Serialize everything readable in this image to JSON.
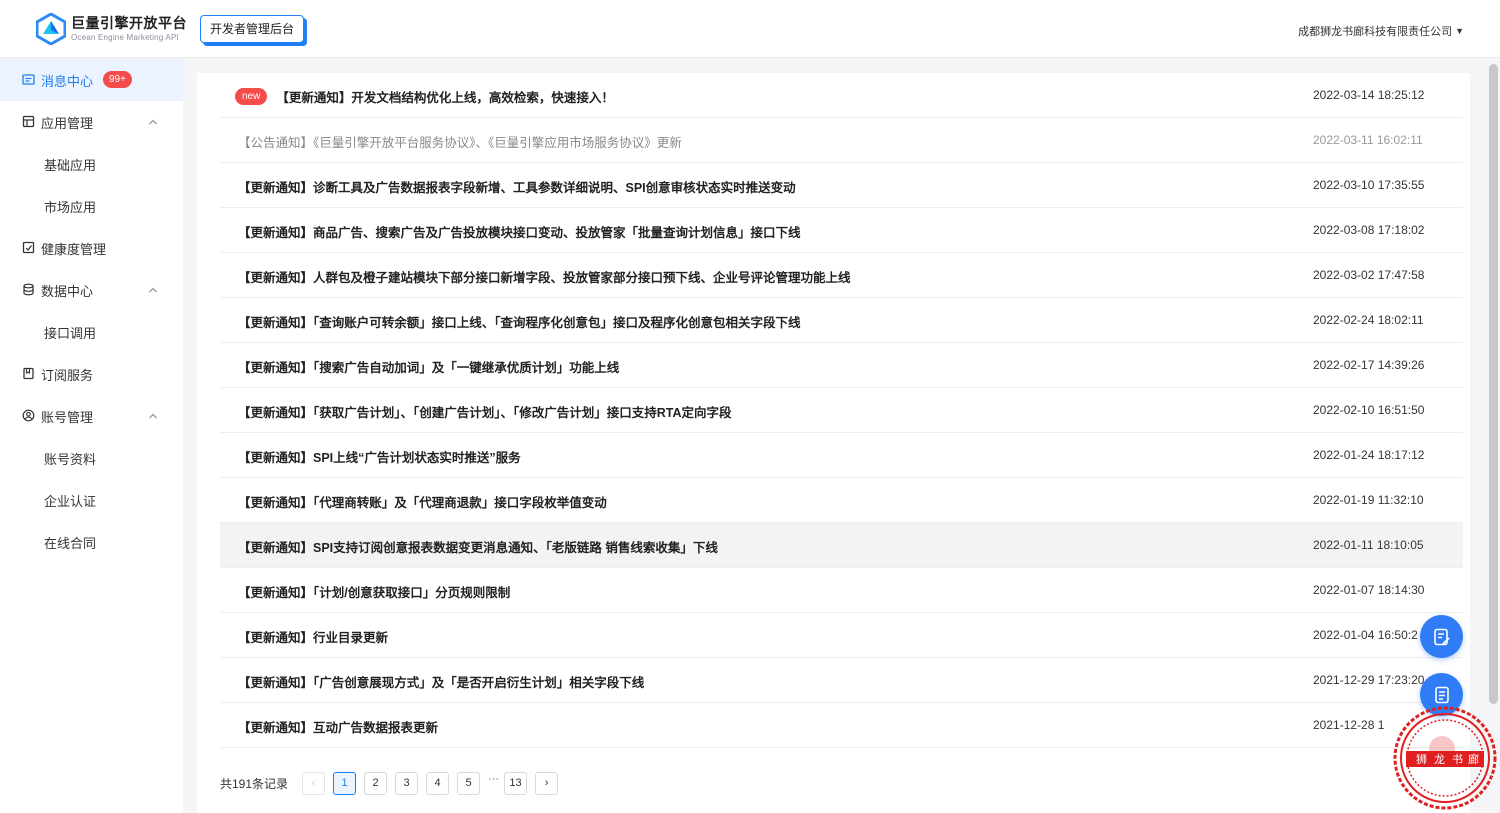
{
  "header": {
    "brand_title": "巨量引擎开放平台",
    "brand_subtitle": "Ocean Engine Marketing API",
    "dev_badge": "开发者管理后台",
    "company": "成都狮龙书廊科技有限责任公司",
    "accent_color": "#1e7ef2"
  },
  "sidebar": {
    "items": [
      {
        "label": "消息中心",
        "icon": "message-icon",
        "badge": "99+",
        "active": true
      },
      {
        "label": "应用管理",
        "icon": "app-icon",
        "expanded": true
      },
      {
        "label": "基础应用",
        "sub": true
      },
      {
        "label": "市场应用",
        "sub": true
      },
      {
        "label": "健康度管理",
        "icon": "health-icon"
      },
      {
        "label": "数据中心",
        "icon": "database-icon",
        "expanded": true
      },
      {
        "label": "接口调用",
        "sub": true
      },
      {
        "label": "订阅服务",
        "icon": "bookmark-icon"
      },
      {
        "label": "账号管理",
        "icon": "account-icon",
        "expanded": true
      },
      {
        "label": "账号资料",
        "sub": true
      },
      {
        "label": "企业认证",
        "sub": true
      },
      {
        "label": "在线合同",
        "sub": true
      }
    ]
  },
  "messages": [
    {
      "title": "【更新通知】开发文档结构优化上线，高效检索，快速接入！",
      "time": "2022-03-14 18:25:12",
      "is_new": true,
      "new_label": "new",
      "read": false
    },
    {
      "title": "【公告通知】《巨量引擎开放平台服务协议》、《巨量引擎应用市场服务协议》更新",
      "time": "2022-03-11 16:02:11",
      "read": true
    },
    {
      "title": "【更新通知】诊断工具及广告数据报表字段新增、工具参数详细说明、SPI创意审核状态实时推送变动",
      "time": "2022-03-10 17:35:55",
      "read": false
    },
    {
      "title": "【更新通知】商品广告、搜索广告及广告投放模块接口变动、投放管家「批量查询计划信息」接口下线",
      "time": "2022-03-08 17:18:02",
      "read": false
    },
    {
      "title": "【更新通知】人群包及橙子建站模块下部分接口新增字段、投放管家部分接口预下线、企业号评论管理功能上线",
      "time": "2022-03-02 17:47:58",
      "read": false
    },
    {
      "title": "【更新通知】「查询账户可转余额」接口上线、「查询程序化创意包」接口及程序化创意包相关字段下线",
      "time": "2022-02-24 18:02:11",
      "read": false
    },
    {
      "title": "【更新通知】「搜索广告自动加词」及「一键继承优质计划」功能上线",
      "time": "2022-02-17 14:39:26",
      "read": false
    },
    {
      "title": "【更新通知】「获取广告计划」、「创建广告计划」、「修改广告计划」接口支持RTA定向字段",
      "time": "2022-02-10 16:51:50",
      "read": false
    },
    {
      "title": "【更新通知】SPI上线“广告计划状态实时推送”服务",
      "time": "2022-01-24 18:17:12",
      "read": false
    },
    {
      "title": "【更新通知】「代理商转账」及「代理商退款」接口字段枚举值变动",
      "time": "2022-01-19 11:32:10",
      "read": false
    },
    {
      "title": "【更新通知】SPI支持订阅创意报表数据变更消息通知、「老版链路 销售线索收集」下线",
      "time": "2022-01-11 18:10:05",
      "read": false,
      "hover": true
    },
    {
      "title": "【更新通知】「计划/创意获取接口」分页规则限制",
      "time": "2022-01-07 18:14:30",
      "read": false
    },
    {
      "title": "【更新通知】行业目录更新",
      "time": "2022-01-04 16:50:2",
      "read": false
    },
    {
      "title": "【更新通知】「广告创意展现方式」及「是否开启衍生计划」相关字段下线",
      "time": "2021-12-29 17:23:20",
      "read": false
    },
    {
      "title": "【更新通知】互动广告数据报表更新",
      "time": "2021-12-28 1",
      "read": false
    }
  ],
  "pagination": {
    "total": "共191条记录",
    "prev": "‹",
    "pages": [
      "1",
      "2",
      "3",
      "4",
      "5"
    ],
    "current": "1",
    "ellipsis": "···",
    "last": "13",
    "next": "›"
  },
  "seal_text": [
    "狮",
    "龙",
    "书",
    "廊"
  ]
}
